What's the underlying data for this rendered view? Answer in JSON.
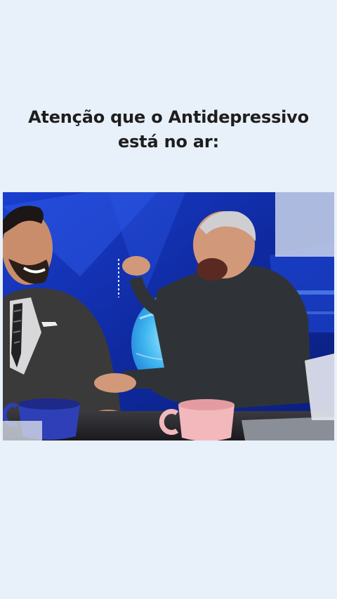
{
  "caption": {
    "line1": "Atenção que o Antidepressivo",
    "line2": "está no ar:"
  },
  "photo": {
    "subject": "two-men-laughing-at-news-desk",
    "colors": {
      "studio_blue": "#1340c8",
      "globe_cyan": "#3fb6f0",
      "desk": "#2a2a2e",
      "blue_mug": "#2f3fb8",
      "pink_mug": "#f2b8bc"
    }
  }
}
